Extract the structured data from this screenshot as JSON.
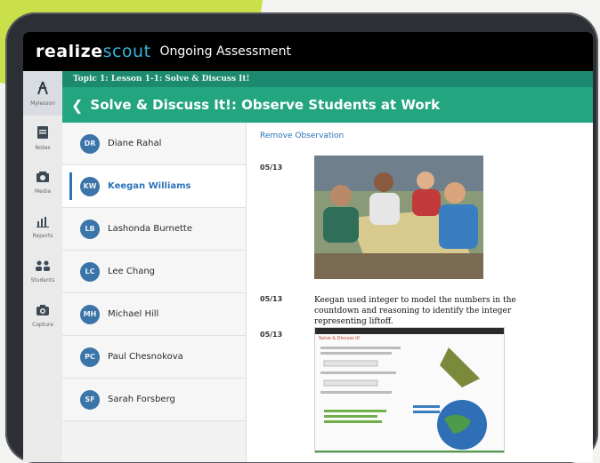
{
  "app": {
    "brand_part1": "realize",
    "brand_part2": "scout",
    "title": "Ongoing Assessment"
  },
  "rail": [
    {
      "label": "Mylesson",
      "icon": "compass-icon"
    },
    {
      "label": "Notes",
      "icon": "notes-icon"
    },
    {
      "label": "Media",
      "icon": "media-icon"
    },
    {
      "label": "Reports",
      "icon": "reports-icon"
    },
    {
      "label": "Students",
      "icon": "students-icon"
    },
    {
      "label": "Capture",
      "icon": "camera-icon"
    }
  ],
  "header": {
    "topic": "Topic 1: Lesson 1-1: Solve & Discuss It!",
    "lesson_title": "Solve & Discuss It!: Observe Students at Work"
  },
  "students": [
    {
      "initials": "DR",
      "name": "Diane Rahal"
    },
    {
      "initials": "KW",
      "name": "Keegan Williams"
    },
    {
      "initials": "LB",
      "name": "Lashonda Burnette"
    },
    {
      "initials": "LC",
      "name": "Lee Chang"
    },
    {
      "initials": "MH",
      "name": "Michael Hill"
    },
    {
      "initials": "PC",
      "name": "Paul Chesnokova"
    },
    {
      "initials": "SF",
      "name": "Sarah Forsberg"
    }
  ],
  "observations": {
    "remove_label": "Remove Observation",
    "items": [
      {
        "date": "05/13"
      },
      {
        "date": "05/13",
        "text": "Keegan used integer to model the numbers in the countdown and reasoning to identify the integer representing liftoff."
      },
      {
        "date": "05/13"
      }
    ]
  },
  "embedded_screen": {
    "title": "Solve & Discuss It!"
  }
}
